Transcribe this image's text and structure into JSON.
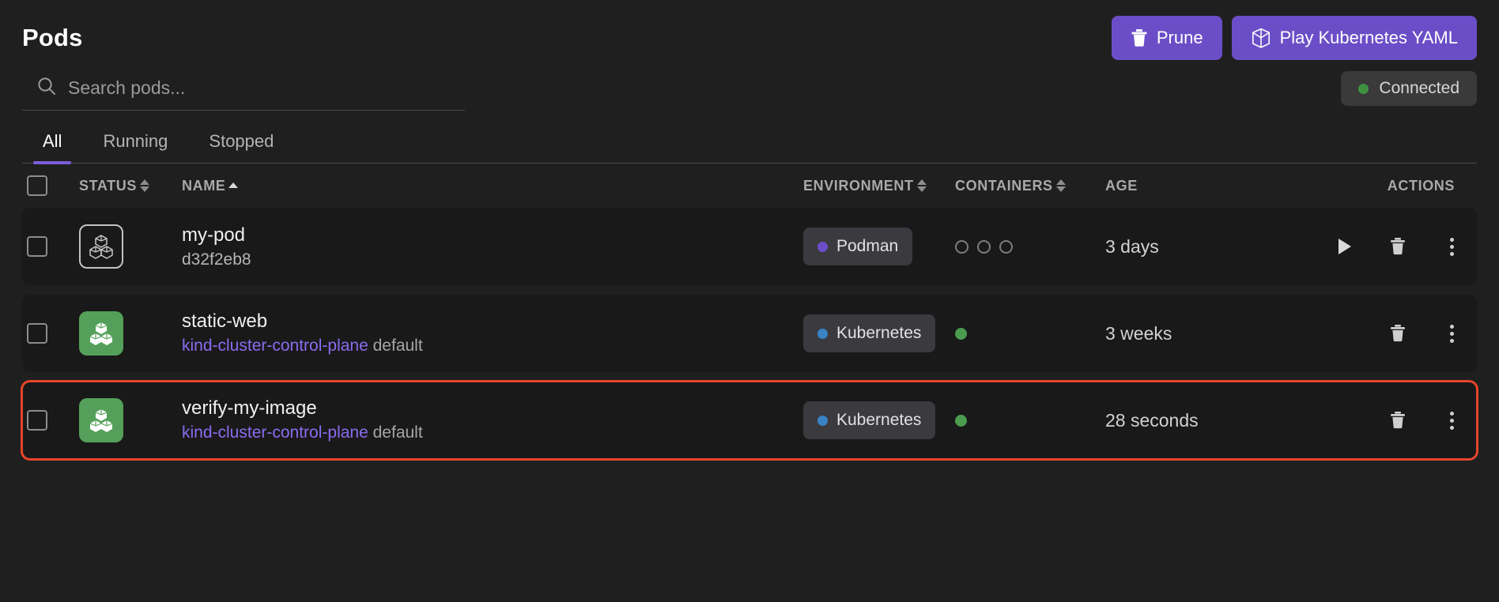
{
  "header": {
    "title": "Pods",
    "prune_label": "Prune",
    "play_yaml_label": "Play Kubernetes YAML",
    "prune_icon": "trash-icon",
    "play_yaml_icon": "cube-icon"
  },
  "search": {
    "placeholder": "Search pods...",
    "value": "",
    "icon": "search-icon"
  },
  "connection": {
    "label": "Connected",
    "status_color": "#3f9142",
    "indicator_icon": "status-dot-icon"
  },
  "tabs": [
    {
      "label": "All",
      "active": true
    },
    {
      "label": "Running",
      "active": false
    },
    {
      "label": "Stopped",
      "active": false
    }
  ],
  "table": {
    "columns": {
      "status": "STATUS",
      "name": "NAME",
      "environment": "ENVIRONMENT",
      "containers": "CONTAINERS",
      "age": "AGE",
      "actions": "ACTIONS"
    },
    "sort": {
      "column": "NAME",
      "direction": "asc"
    },
    "rows": [
      {
        "name": "my-pod",
        "subtitle": "d32f2eb8",
        "subtitle_kind": "hash",
        "cluster": "",
        "namespace": "",
        "icon_style": "outline",
        "icon": "pod-cubes-icon",
        "environment": "Podman",
        "environment_dot_color": "#6b4ec7",
        "containers": {
          "type": "rings",
          "count": 3
        },
        "age": "3 days",
        "actions": [
          "play-icon",
          "trash-icon",
          "kebab-icon"
        ],
        "highlighted": false
      },
      {
        "name": "static-web",
        "subtitle": "",
        "subtitle_kind": "cluster",
        "cluster": "kind-cluster-control-plane",
        "namespace": "default",
        "icon_style": "green",
        "icon": "pod-cubes-icon",
        "environment": "Kubernetes",
        "environment_dot_color": "#3883c4",
        "containers": {
          "type": "solid",
          "count": 1
        },
        "age": "3 weeks",
        "actions": [
          "trash-icon",
          "kebab-icon"
        ],
        "highlighted": false
      },
      {
        "name": "verify-my-image",
        "subtitle": "",
        "subtitle_kind": "cluster",
        "cluster": "kind-cluster-control-plane",
        "namespace": "default",
        "icon_style": "green",
        "icon": "pod-cubes-icon",
        "environment": "Kubernetes",
        "environment_dot_color": "#3883c4",
        "containers": {
          "type": "solid",
          "count": 1
        },
        "age": "28 seconds",
        "actions": [
          "trash-icon",
          "kebab-icon"
        ],
        "highlighted": true,
        "highlight_color": "#e8442a"
      }
    ]
  },
  "colors": {
    "accent": "#6b4ec7",
    "background": "#1f1f1f",
    "row_background": "#191919",
    "green": "#54a05a",
    "link_purple": "#8a6cf0"
  }
}
